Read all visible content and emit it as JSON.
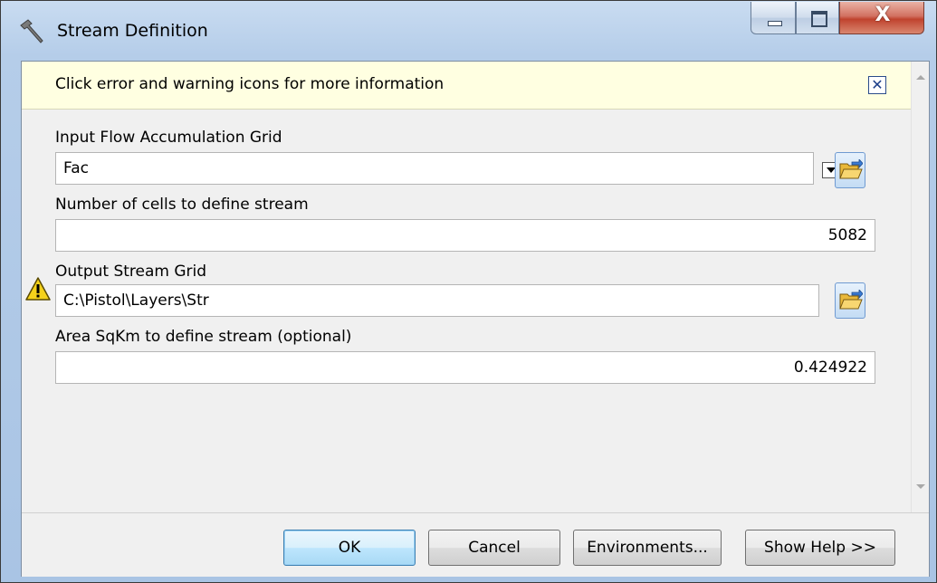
{
  "window": {
    "title": "Stream Definition",
    "close_glyph": "X"
  },
  "infobar": {
    "text": "Click error and warning icons for more information",
    "close_glyph": "✕"
  },
  "fields": {
    "flow_acc": {
      "label": "Input Flow Accumulation Grid",
      "value": "Fac"
    },
    "num_cells": {
      "label": "Number of cells to define stream",
      "value": "5082"
    },
    "output_grid": {
      "label": "Output Stream Grid",
      "value": "C:\\Pistol\\Layers\\Str"
    },
    "area": {
      "label": "Area SqKm to define stream (optional)",
      "value": "0.424922"
    }
  },
  "buttons": {
    "ok": "OK",
    "cancel": "Cancel",
    "environments": "Environments...",
    "show_help": "Show Help >>"
  },
  "colors": {
    "infobar_bg": "#ffffe1",
    "frame": "#b5cde9",
    "close_button": "#c0432e",
    "warning": "#f5d21b"
  },
  "icons": {
    "app": "hammer-icon",
    "browse": "folder-open-icon",
    "warning": "warning-icon"
  }
}
